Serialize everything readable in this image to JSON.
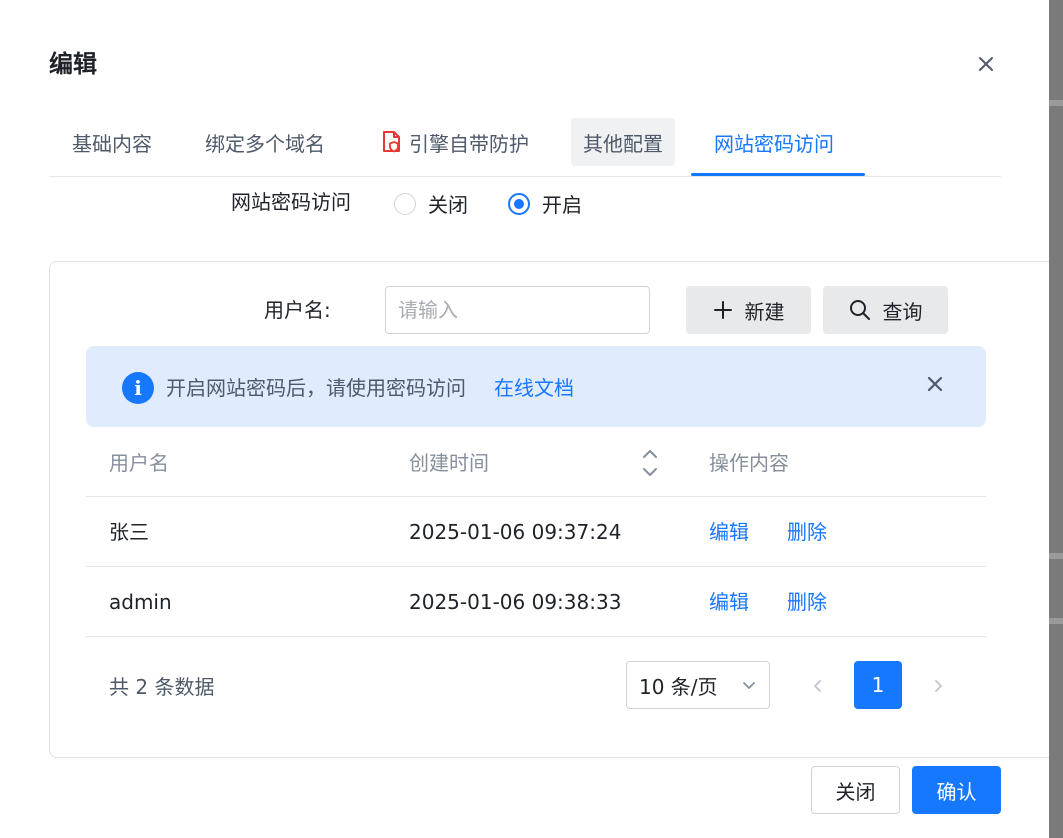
{
  "dialog": {
    "title": "编辑",
    "tabs": [
      {
        "label": "基础内容"
      },
      {
        "label": "绑定多个域名"
      },
      {
        "label": "引擎自带防护"
      },
      {
        "label": "其他配置"
      },
      {
        "label": "网站密码访问"
      }
    ],
    "active_tab": "网站密码访问"
  },
  "password_access": {
    "label": "网站密码访问",
    "options": [
      {
        "label": "关闭",
        "checked": false
      },
      {
        "label": "开启",
        "checked": true
      }
    ]
  },
  "search": {
    "username_label": "用户名:",
    "placeholder": "请输入",
    "value": "",
    "new_button": "新建",
    "query_button": "查询"
  },
  "alert": {
    "text": "开启网站密码后，请使用密码访问",
    "link": "在线文档"
  },
  "table": {
    "columns": [
      "用户名",
      "创建时间",
      "操作内容"
    ],
    "rows": [
      {
        "username": "张三",
        "created": "2025-01-06 09:37:24",
        "edit": "编辑",
        "delete": "删除"
      },
      {
        "username": "admin",
        "created": "2025-01-06 09:38:33",
        "edit": "编辑",
        "delete": "删除"
      }
    ]
  },
  "pagination": {
    "total_text": "共 2 条数据",
    "page_size": "10 条/页",
    "current_page": "1"
  },
  "footer": {
    "close": "关闭",
    "confirm": "确认"
  },
  "colors": {
    "primary": "#1677ff",
    "alert_bg": "#e0ebfd",
    "danger_icon": "#e53935"
  },
  "icons": [
    "close-icon",
    "document-shield-icon",
    "plus-icon",
    "search-icon",
    "info-icon",
    "sort-icon",
    "chevron-down-icon",
    "chevron-left-icon",
    "chevron-right-icon"
  ]
}
